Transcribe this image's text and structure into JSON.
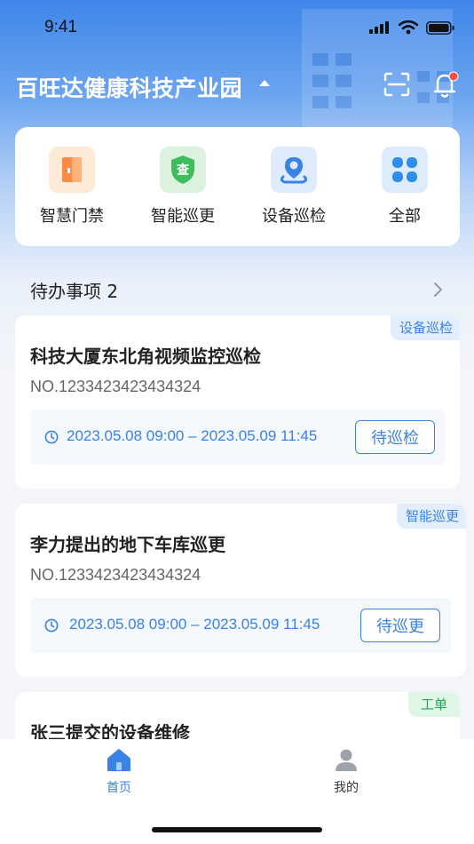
{
  "status_bar": {
    "time": "9:41"
  },
  "header": {
    "park_name": "百旺达健康科技产业园",
    "has_notification": true
  },
  "quick_actions": [
    {
      "label": "智慧门禁",
      "icon": "door-icon",
      "color": "#f98a47"
    },
    {
      "label": "智能巡更",
      "icon": "patrol-check-icon",
      "color": "#3fbc5b"
    },
    {
      "label": "设备巡检",
      "icon": "location-pin-icon",
      "color": "#3a82e4"
    },
    {
      "label": "全部",
      "icon": "grid-apps-icon",
      "color": "#2f8ee9"
    }
  ],
  "todo": {
    "title": "待办事项 2"
  },
  "tasks": [
    {
      "tag": "设备巡检",
      "title": "科技大厦东北角视频监控巡检",
      "number": "NO.1233423423434324",
      "time": "2023.05.08 09:00 – 2023.05.09 11:45",
      "action": "待巡检"
    },
    {
      "tag": "智能巡更",
      "title": "李力提出的地下车库巡更",
      "number": "NO.1233423423434324",
      "time": "2023.05.08 09:00 – 2023.05.09 11:45",
      "action": "待巡更"
    },
    {
      "tag": "工单",
      "title": "张三提交的设备维修"
    }
  ],
  "tabbar": {
    "items": [
      {
        "label": "首页",
        "icon": "home-icon",
        "active": true
      },
      {
        "label": "我的",
        "icon": "user-icon",
        "active": false
      }
    ]
  },
  "colors": {
    "accent": "#3a82e4",
    "tag_blue_bg": "#e3eefd",
    "tag_green_bg": "#dff5e6",
    "tag_green_text": "#28a659",
    "notification_dot": "#f0533d"
  }
}
